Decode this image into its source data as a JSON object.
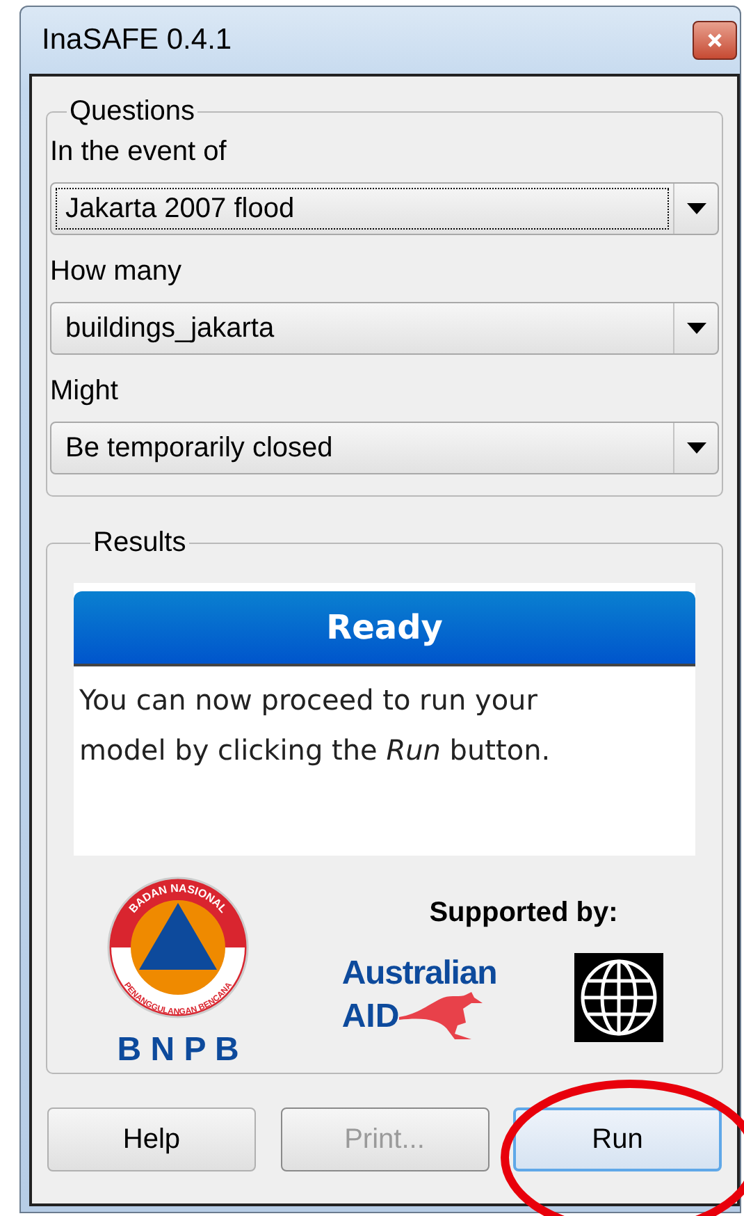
{
  "window": {
    "title": "InaSAFE 0.4.1"
  },
  "questions": {
    "title": "Questions",
    "fields": [
      {
        "label": "In the event of",
        "value": "Jakarta 2007 flood",
        "focused": true
      },
      {
        "label": "How many",
        "value": "buildings_jakarta",
        "focused": false
      },
      {
        "label": "Might",
        "value": "Be temporarily closed",
        "focused": false
      }
    ]
  },
  "results": {
    "title": "Results",
    "status": "Ready",
    "message": "You can now proceed to run your model by clicking the *Run* button."
  },
  "logos": {
    "bnpb_ring_top": "BADAN NASIONAL",
    "bnpb_ring_bottom": "PENANGGULANGAN BENCANA",
    "bnpb": "B N P B",
    "supported_by": "Supported by:",
    "aid_line_1": "Australian",
    "aid_line_2": "AID"
  },
  "buttons": [
    {
      "label": "Help",
      "disabled": false,
      "default": false
    },
    {
      "label": "Print...",
      "disabled": true,
      "default": false
    },
    {
      "label": "Run",
      "disabled": false,
      "default": true
    }
  ],
  "annotation": {
    "kind": "ellipse"
  }
}
